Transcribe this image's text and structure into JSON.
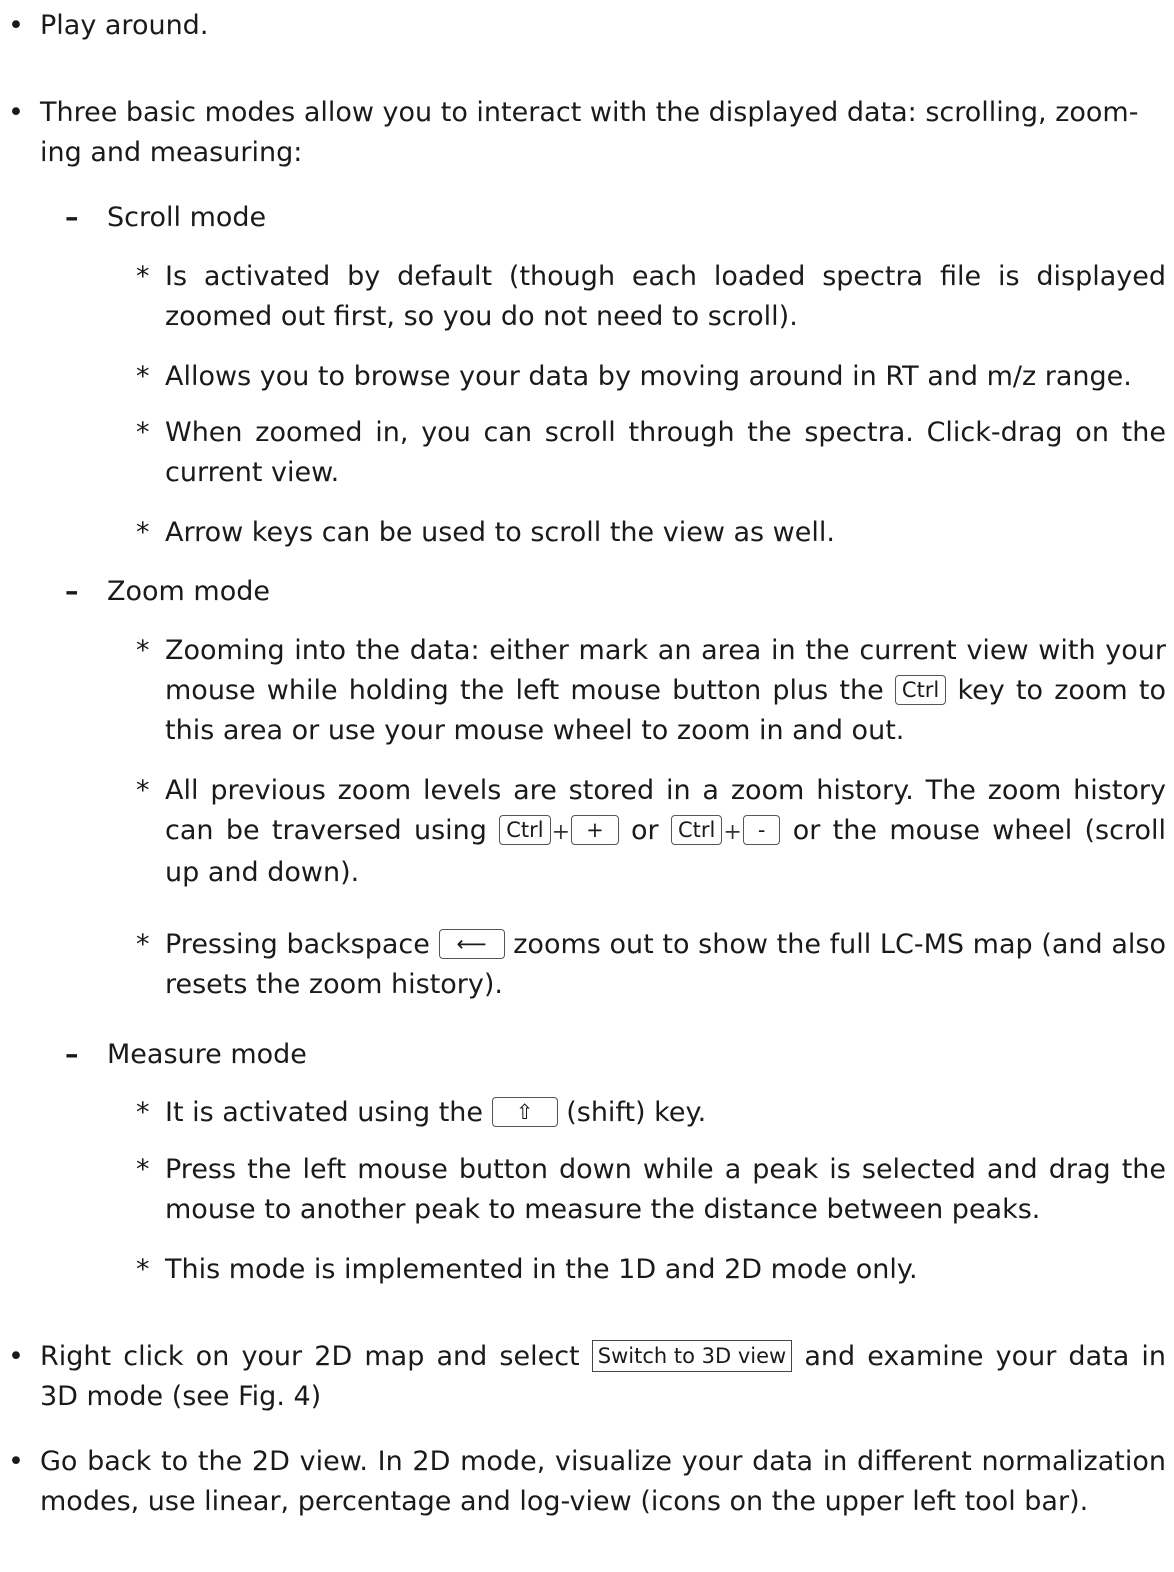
{
  "bullets": {
    "l1": "•",
    "l2": "–",
    "l3": "*"
  },
  "keys": {
    "ctrl": "Ctrl",
    "plus_key": "+",
    "minus_key": "-",
    "plus_sign": "+",
    "backspace": "⟵",
    "shift": "⇧"
  },
  "items": {
    "play": "Play around.",
    "modes_intro_1": "Three basic modes allow you to interact with the displayed data: scrolling, zoom-",
    "modes_intro_2": "ing and measuring:",
    "scroll_mode": "Scroll mode",
    "scroll_1": "Is activated by default (though each loaded spectra file is displayed zoomed out first, so you do not need to scroll).",
    "scroll_2": "Allows you to browse your data by moving around in RT and m/z range.",
    "scroll_3": "When zoomed in, you can scroll through the spectra. Click-drag on the current view.",
    "scroll_4": "Arrow keys can be used to scroll the view as well.",
    "zoom_mode": "Zoom mode",
    "zoom_1a": "Zooming into the data: either mark an area in the current view with your mouse while holding the left mouse button plus the",
    "zoom_1b": "key to zoom to this area or use your mouse wheel to zoom in and out.",
    "zoom_2a": "All previous zoom levels are stored in a zoom history. The zoom history can be traversed using",
    "zoom_2b": "or",
    "zoom_2c": "or the mouse wheel (scroll up and down).",
    "zoom_3a": "Pressing backspace",
    "zoom_3b": "zooms out to show the full LC-MS map (and also resets the zoom history).",
    "measure_mode": "Measure mode",
    "measure_1a": "It is activated using the",
    "measure_1b": "(shift) key.",
    "measure_2": "Press the left mouse button down while a peak is selected and drag the mouse to another peak to measure the distance between peaks.",
    "measure_3": "This mode is implemented in the 1D and 2D mode only.",
    "right_click_a": "Right click on your 2D map and select",
    "right_click_menu": "Switch to 3D view",
    "right_click_b": "and examine your data in 3D mode (see Fig.  4)",
    "back_2d": "Go back to the 2D view. In 2D mode, visualize your data in different normalization modes, use linear, percentage and log-view (icons on the upper left tool bar)."
  }
}
